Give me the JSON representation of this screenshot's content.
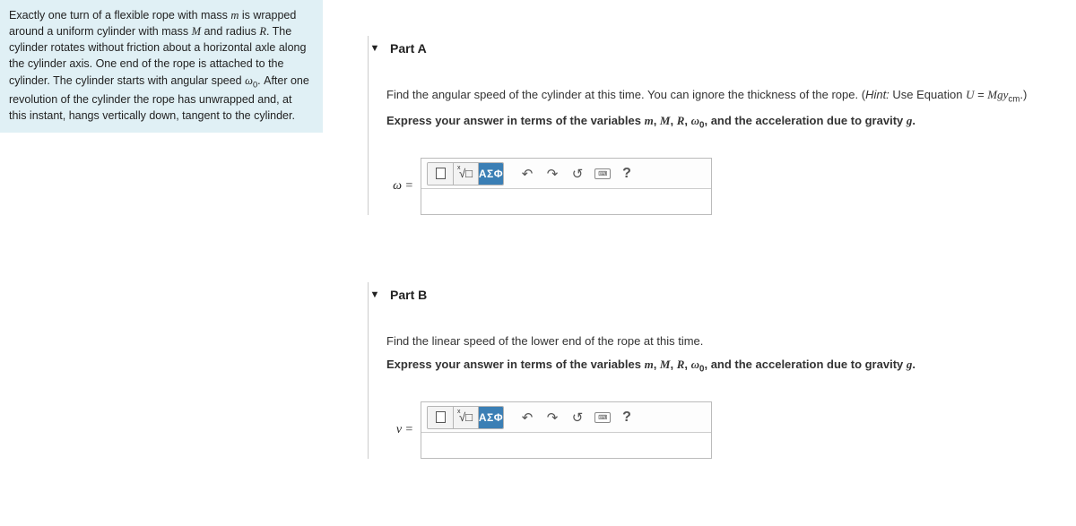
{
  "problem": {
    "text_html": "Exactly one turn of a flexible rope with mass <span class='ital'>m</span> is wrapped around a uniform cylinder with mass <span class='ital'>M</span> and radius <span class='ital'>R</span>. The cylinder rotates without friction about a horizontal axle along the cylinder axis. One end of the rope is attached to the cylinder. The cylinder starts with angular speed <span class='ital'>ω</span><span class='sub'>0</span>. After one revolution of the cylinder the rope has unwrapped and, at this instant, hangs vertically down, tangent to the cylinder."
  },
  "parts": [
    {
      "title": "Part A",
      "prompt_html": "Find the angular speed of the cylinder at this time. You can ignore the thickness of the rope. (<span class='hint-label'>Hint:</span> Use Equation <span class='ital'>U</span> = <span class='ital'>Mg</span><span class='ital'>y</span><span class='sub'>cm</span>.)",
      "express_html": "Express your answer in terms of the variables <span class='ital'>m</span>, <span class='ital'>M</span>, <span class='ital'>R</span>, <span class='ital'>ω</span><span class='sub'>0</span>, and the acceleration due to gravity <span class='ital'>g</span>.",
      "var_label": "ω =",
      "value": ""
    },
    {
      "title": "Part B",
      "prompt_html": "Find the linear speed of the lower end of the rope at this time.",
      "express_html": "Express your answer in terms of the variables <span class='ital'>m</span>, <span class='ital'>M</span>, <span class='ital'>R</span>, <span class='ital'>ω</span><span class='sub'>0</span>, and the acceleration due to gravity <span class='ital'>g</span>.",
      "var_label": "v =",
      "value": ""
    }
  ],
  "toolbar": {
    "greek_label": "ΑΣΦ",
    "help_label": "?"
  }
}
